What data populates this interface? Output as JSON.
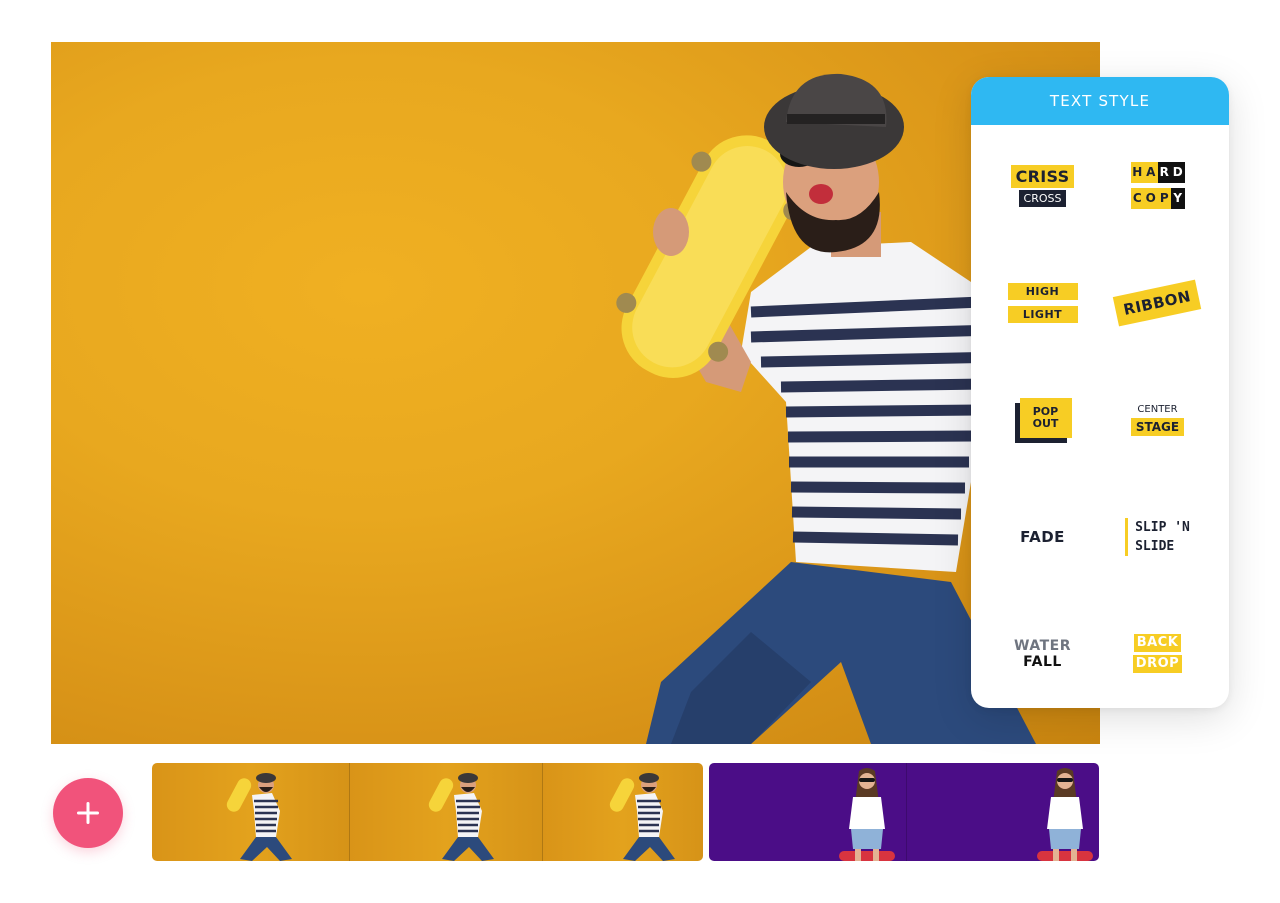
{
  "panel": {
    "title": "TEXT STYLE",
    "styles": {
      "criss_cross": {
        "top": "CRISS",
        "bottom": "CROSS"
      },
      "hard_copy": {
        "row1": [
          "H",
          "A",
          "R",
          "D"
        ],
        "row2": [
          "C",
          "O",
          "P",
          "Y"
        ]
      },
      "high_light": {
        "top": "HIGH",
        "bottom": "LIGHT"
      },
      "ribbon": {
        "label": "RIBBON"
      },
      "pop_out": {
        "top": "POP",
        "bottom": "OUT"
      },
      "center_stage": {
        "top": "CENTER",
        "bottom": "STAGE"
      },
      "fade": {
        "label": "FADE"
      },
      "slip_n_slide": {
        "top": "SLIP 'N",
        "bottom": "SLIDE"
      },
      "water_fall": {
        "top": "WATER",
        "bottom": "FALL"
      },
      "back_drop": {
        "top": "BACK",
        "bottom": "DROP"
      }
    }
  },
  "colors": {
    "panel_header": "#2fb8f2",
    "accent_yellow": "#f7cd24",
    "dark_text": "#1c2131",
    "add_button": "#f1537b",
    "clip_purple": "#4b0d87",
    "preview_orange": "#e8a81f"
  },
  "icons": {
    "add_button": "plus-icon"
  },
  "timeline": {
    "clips": [
      {
        "subject": "man-with-skateboard",
        "background": "orange",
        "frames": 3
      },
      {
        "subject": "woman-with-skateboard",
        "background": "purple",
        "frames": 2
      }
    ]
  }
}
